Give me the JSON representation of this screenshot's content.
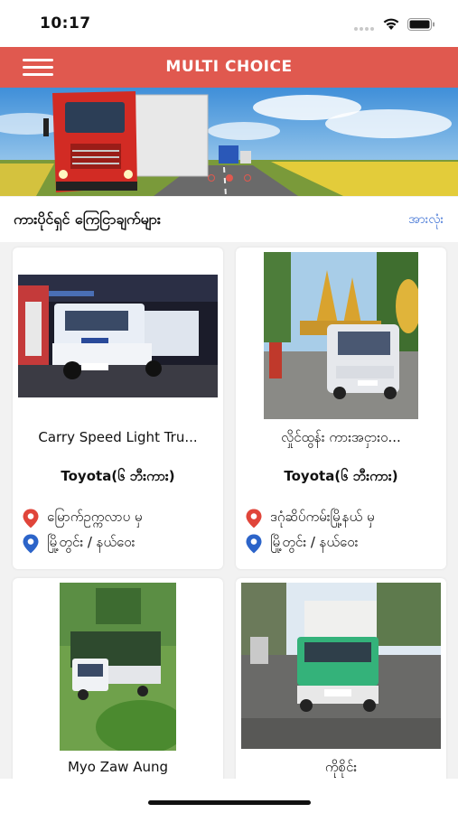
{
  "status_bar": {
    "time": "10:17"
  },
  "header": {
    "title": "MULTI CHOICE"
  },
  "banner": {
    "slide_count": 3,
    "active_slide": 2
  },
  "section": {
    "title": "ကားပိုင်ရှင် ကြေငြာချက်များ",
    "see_all": "အားလုံး"
  },
  "listings": [
    {
      "name": "Carry Speed Light Tru...",
      "brand": "Toyota(၆ ဘီးကား)",
      "from": "မြောက်ဥက္ကလာပ မှ",
      "to": "မြို့တွင်း / နယ်ဝေး"
    },
    {
      "name": "လှိုင်ထွန်း ကားအငှားဝ...",
      "brand": "Toyota(၆ ဘီးကား)",
      "from": "ဒဂုံဆိပ်ကမ်းမြို့နယ် မှ",
      "to": "မြို့တွင်း / နယ်ဝေး"
    },
    {
      "name": "Myo Zaw Aung"
    },
    {
      "name": "ကိုစိုင်း"
    }
  ],
  "colors": {
    "brand": "#e0594f",
    "link": "#3b6fd4",
    "pin_from": "#e0453a",
    "pin_to": "#2c64c9"
  },
  "icons": {
    "menu": "hamburger-menu-icon",
    "from_pin": "location-pin-icon",
    "to_pin": "location-pin-icon"
  }
}
